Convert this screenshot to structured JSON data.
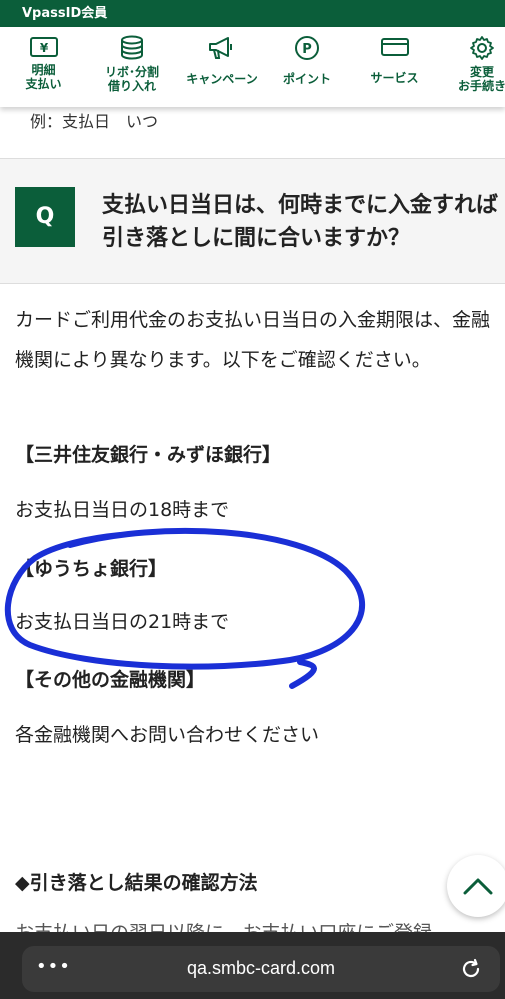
{
  "header": {
    "member_label": "VpassID会員"
  },
  "nav": {
    "items": [
      {
        "label": "明細\n支払い",
        "icon": "yen-card-icon"
      },
      {
        "label": "リボ･分割\n借り入れ",
        "icon": "coin-stack-icon"
      },
      {
        "label": "キャンペーン",
        "icon": "megaphone-icon"
      },
      {
        "label": "ポイント",
        "icon": "point-p-icon"
      },
      {
        "label": "サービス",
        "icon": "card-icon"
      },
      {
        "label": "変更\nお手続き",
        "icon": "gear-icon"
      }
    ]
  },
  "content": {
    "example_text": "例：支払日　いつ",
    "question_mark": "Q",
    "question_text": "支払い日当日は、何時までに入金すれば引き落としに間に合いますか？",
    "answer_intro": "カードご利用代金のお支払い日当日の入金期限は、金融機関により異なります。以下をご確認ください。",
    "sections": [
      {
        "heading": "【三井住友銀行・みずほ銀行】",
        "detail": "お支払日当日の18時まで"
      },
      {
        "heading": "【ゆうちょ銀行】",
        "detail": "お支払日当日の21時まで"
      },
      {
        "heading": "【その他の金融機関】",
        "detail": "各金融機関へお問い合わせください"
      }
    ],
    "next_heading": "◆引き落とし結果の確認方法",
    "partial_text": "お支払い日の翌日以降に、お支払い口座にご登録"
  },
  "browser": {
    "url": "qa.smbc-card.com",
    "menu_dots": "•••"
  },
  "colors": {
    "brand_green": "#0b5e3a",
    "annotation_blue": "#1a2fd6"
  }
}
